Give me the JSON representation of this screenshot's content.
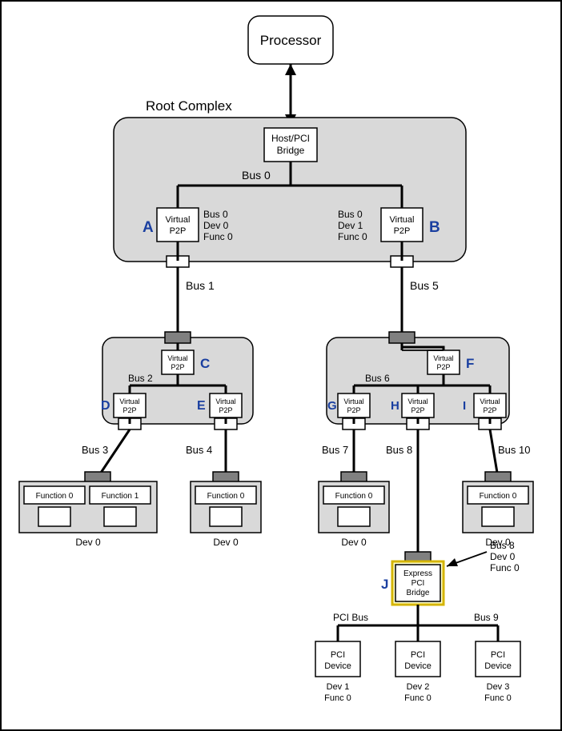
{
  "processor": "Processor",
  "root_complex_title": "Root Complex",
  "host_bridge_l1": "Host/PCI",
  "host_bridge_l2": "Bridge",
  "vp2p_l1": "Virtual",
  "vp2p_l2": "P2P",
  "bus0": "Bus 0",
  "bus1": "Bus 1",
  "bus2": "Bus 2",
  "bus3": "Bus 3",
  "bus4": "Bus 4",
  "bus5": "Bus 5",
  "bus6": "Bus 6",
  "bus7": "Bus 7",
  "bus8": "Bus 8",
  "bus9": "Bus 9",
  "bus10": "Bus 10",
  "pci_bus": "PCI Bus",
  "bdA_l1": "Bus 0",
  "bdA_l2": "Dev 0",
  "bdA_l3": "Func 0",
  "bdB_l1": "Bus 0",
  "bdB_l2": "Dev 1",
  "bdB_l3": "Func 0",
  "bdJ_l1": "Bus 8",
  "bdJ_l2": "Dev 0",
  "bdJ_l3": "Func 0",
  "func0": "Function 0",
  "func1": "Function 1",
  "dev0": "Dev 0",
  "pci_dev_l1": "PCI",
  "pci_dev_l2": "Device",
  "dev1": "Dev 1",
  "dev2": "Dev 2",
  "dev3": "Dev 3",
  "funcz": "Func 0",
  "express_l1": "Express",
  "express_l2": "PCI",
  "express_l3": "Bridge",
  "labels": {
    "A": "A",
    "B": "B",
    "C": "C",
    "D": "D",
    "E": "E",
    "F": "F",
    "G": "G",
    "H": "H",
    "I": "I",
    "J": "J"
  }
}
